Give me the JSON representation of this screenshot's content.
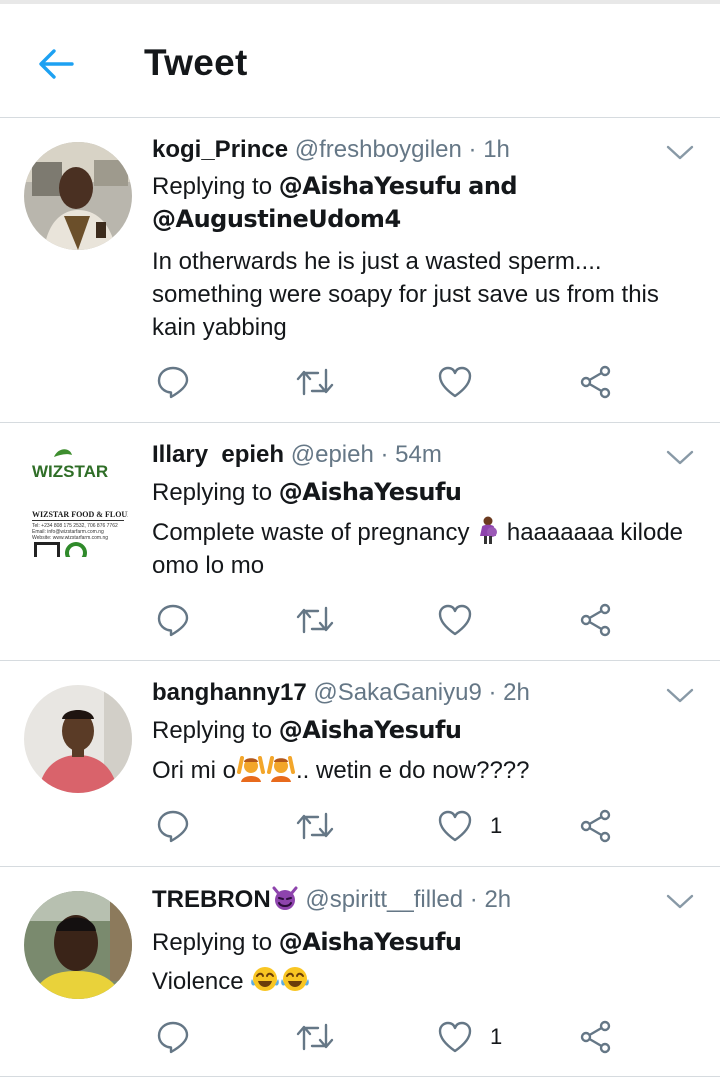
{
  "header": {
    "title": "Tweet",
    "back_icon": "arrow-left-icon",
    "accent": "#1da1f2"
  },
  "tweets": [
    {
      "name": "kogi_Prince",
      "handle": "@freshboygilen",
      "time": "· 1h",
      "replying_prefix": "Replying to",
      "mentions": [
        "@AishaYesufu",
        "and",
        "@AugustineUdom4"
      ],
      "text": "In otherwards he is just a wasted sperm.... something were soapy for just save us from this kain yabbing",
      "likes": ""
    },
    {
      "name": "Illary  epieh",
      "handle": "@epieh",
      "time": "· 54m",
      "replying_prefix": "Replying to",
      "mentions": [
        "@AishaYesufu"
      ],
      "text_before": "Complete waste of pregnancy",
      "text_after": "haaaaaaa kilode omo lo mo",
      "likes": "",
      "avatar_text": {
        "brand": "WIZSTAR",
        "sub": "WIZSTAR FOOD & FLOUR",
        "line1": "Tel: +234 808 175 2532, 706 876 7762",
        "line2": "Email: info@wizstarfarm.com.ng",
        "line3": "Website: www.wizstarfarm.com.ng"
      }
    },
    {
      "name": "banghanny17",
      "handle": "@SakaGaniyu9",
      "time": "· 2h",
      "replying_prefix": "Replying to",
      "mentions": [
        "@AishaYesufu"
      ],
      "text_before": "Ori mi o",
      "text_after": ".. wetin e do now????",
      "likes": "1"
    },
    {
      "name": "TREBRON",
      "handle": "@spiritt__filled",
      "time": "· 2h",
      "replying_prefix": "Replying to",
      "mentions": [
        "@AishaYesufu"
      ],
      "text_before": "Violence",
      "likes": "1"
    }
  ],
  "icons": [
    "reply-icon",
    "retweet-icon",
    "like-icon",
    "share-icon",
    "chevron-down-icon"
  ]
}
